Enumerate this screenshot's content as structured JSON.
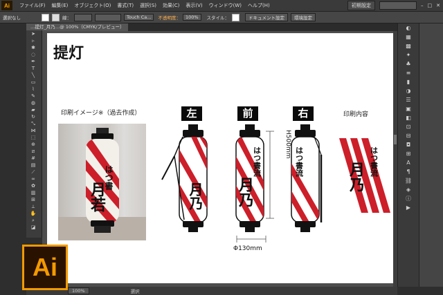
{
  "app": {
    "logo": "Ai"
  },
  "menubar": {
    "items": [
      "ファイル(F)",
      "編集(E)",
      "オブジェクト(O)",
      "書式(T)",
      "選択(S)",
      "効果(C)",
      "表示(V)",
      "ウィンドウ(W)",
      "ヘルプ(H)"
    ],
    "workspace": "初期設定"
  },
  "control_bar": {
    "selection_label": "選択なし",
    "stroke_label": "線：",
    "brush": "Touch Ca...",
    "opacity_label": "不透明度：",
    "opacity_value": "100%",
    "style_label": "スタイル：",
    "doc_settings_button": "ドキュメント設定",
    "prefs_button": "環境設定"
  },
  "document_tab": {
    "label": "…提灯_月乃…@ 100%（CMYK/プレビュー）"
  },
  "artboard": {
    "title": "提灯",
    "photo_caption": "印刷イメージ※（過去作成）",
    "view_labels": {
      "left": "左",
      "front": "前",
      "right": "右"
    },
    "print_caption": "印刷内容",
    "height_dim": "H500mm",
    "width_dim": "Φ130mm",
    "lantern_text_small": "はつ書流",
    "lantern_text_large": "月乃",
    "photo_text_small": "はつ書",
    "photo_text_large": "月若"
  },
  "statusbar": {
    "zoom": "100%",
    "selection": "選択"
  },
  "colors": {
    "stripe_red": "#cc1f2a",
    "ai_orange": "#f39a00",
    "ui_dark": "#2e2e2e"
  }
}
